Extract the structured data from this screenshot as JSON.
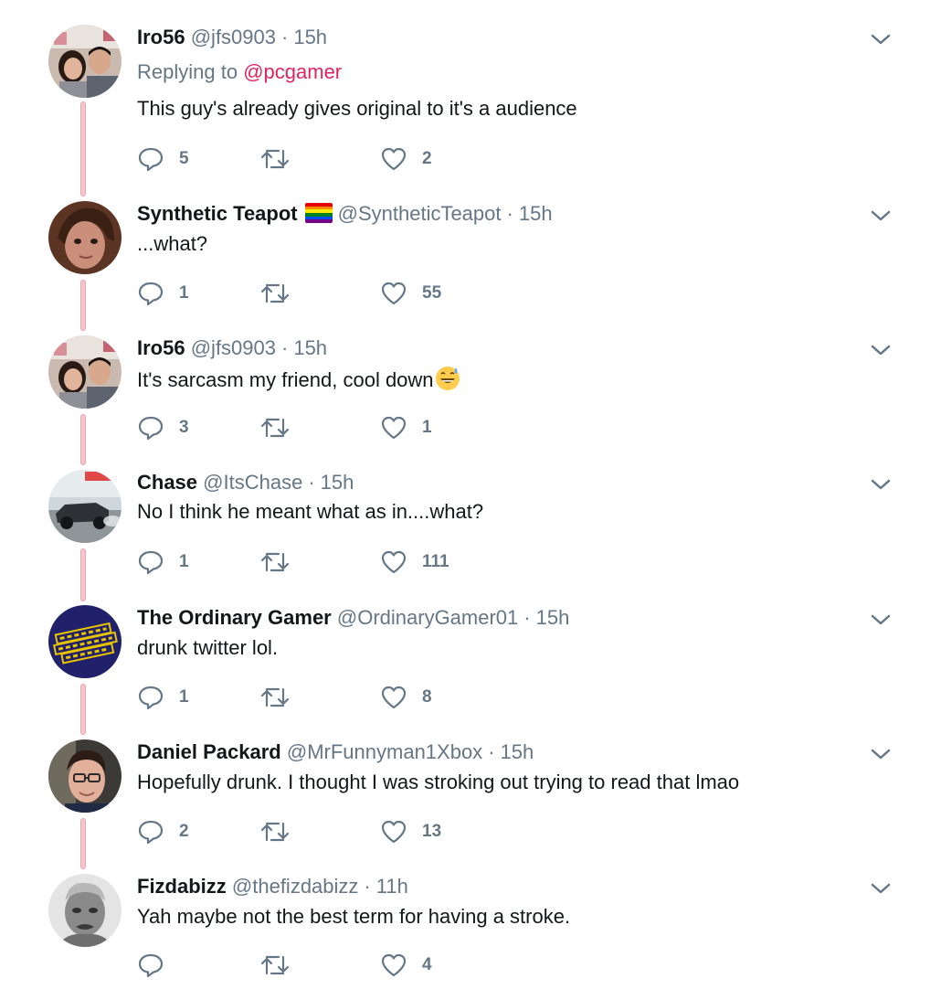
{
  "thread": {
    "tweets": [
      {
        "name": "Iro56",
        "handle": "@jfs0903",
        "time": "15h",
        "reply_prefix": "Replying to",
        "reply_to": "@pcgamer",
        "text": "This guy's already gives original to it's a audience",
        "replies": "5",
        "retweets": "",
        "likes": "2",
        "avatar": "couple-selfie"
      },
      {
        "name": "Synthetic Teapot",
        "handle": "@SyntheticTeapot",
        "time": "15h",
        "text": "...what?",
        "replies": "1",
        "retweets": "",
        "likes": "55",
        "avatar": "woman-portrait",
        "badge": "rainbow-flag-icon"
      },
      {
        "name": "Iro56",
        "handle": "@jfs0903",
        "time": "15h",
        "text": "It's sarcasm my friend, cool down",
        "emoji": "grinning-face-with-sweat-emoji",
        "replies": "3",
        "retweets": "",
        "likes": "1",
        "avatar": "couple-selfie"
      },
      {
        "name": "Chase",
        "handle": "@ItsChase",
        "time": "15h",
        "text": "No I think he meant what as in....what?",
        "replies": "1",
        "retweets": "",
        "likes": "111",
        "avatar": "drag-car"
      },
      {
        "name": "The Ordinary Gamer",
        "handle": "@OrdinaryGamer01",
        "time": "15h",
        "text": "drunk twitter lol.",
        "replies": "1",
        "retweets": "",
        "likes": "8",
        "avatar": "ordinary-gamer-logo"
      },
      {
        "name": "Daniel Packard",
        "handle": "@MrFunnyman1Xbox",
        "time": "15h",
        "text": "Hopefully drunk. I thought I was stroking out trying to read that lmao",
        "replies": "2",
        "retweets": "",
        "likes": "13",
        "avatar": "man-with-glasses"
      },
      {
        "name": "Fizdabizz",
        "handle": "@thefizdabizz",
        "time": "11h",
        "text": "Yah maybe not the best term for having a stroke.",
        "replies": "",
        "retweets": "",
        "likes": "4",
        "avatar": "grey-statue"
      }
    ]
  },
  "colors": {
    "text": "#14171a",
    "muted": "#657786",
    "mention": "#e0245e",
    "thread_line": "#f4c7cf"
  },
  "icons": {
    "reply": "reply-icon",
    "retweet": "retweet-icon",
    "like": "heart-icon",
    "menu": "chevron-down-icon"
  }
}
